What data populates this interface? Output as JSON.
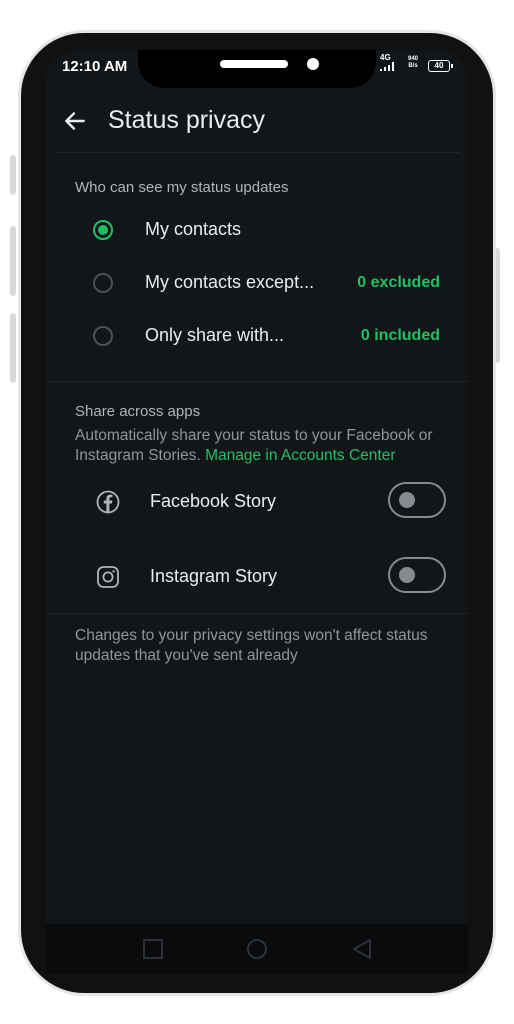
{
  "status_bar": {
    "time": "12:10 AM",
    "network": "4G",
    "speed_value": "940",
    "speed_unit": "B/s",
    "battery": "40"
  },
  "header": {
    "title": "Status privacy"
  },
  "visibility_section": {
    "label": "Who can see my status updates",
    "options": [
      {
        "label": "My contacts",
        "selected": true,
        "count": ""
      },
      {
        "label": "My contacts except...",
        "selected": false,
        "count": "0 excluded"
      },
      {
        "label": "Only share with...",
        "selected": false,
        "count": "0 included"
      }
    ]
  },
  "share_section": {
    "label": "Share across apps",
    "description": "Automatically share your status to your Facebook or Instagram Stories.",
    "link": "Manage in Accounts Center",
    "items": [
      {
        "label": "Facebook Story",
        "icon": "facebook-icon",
        "enabled": false
      },
      {
        "label": "Instagram Story",
        "icon": "instagram-icon",
        "enabled": false
      }
    ]
  },
  "footer": {
    "note": "Changes to your privacy settings won't affect status updates that you've sent already"
  },
  "colors": {
    "accent": "#21c063",
    "background": "#121619",
    "text_primary": "#e9edef",
    "text_secondary": "#8d969b"
  }
}
